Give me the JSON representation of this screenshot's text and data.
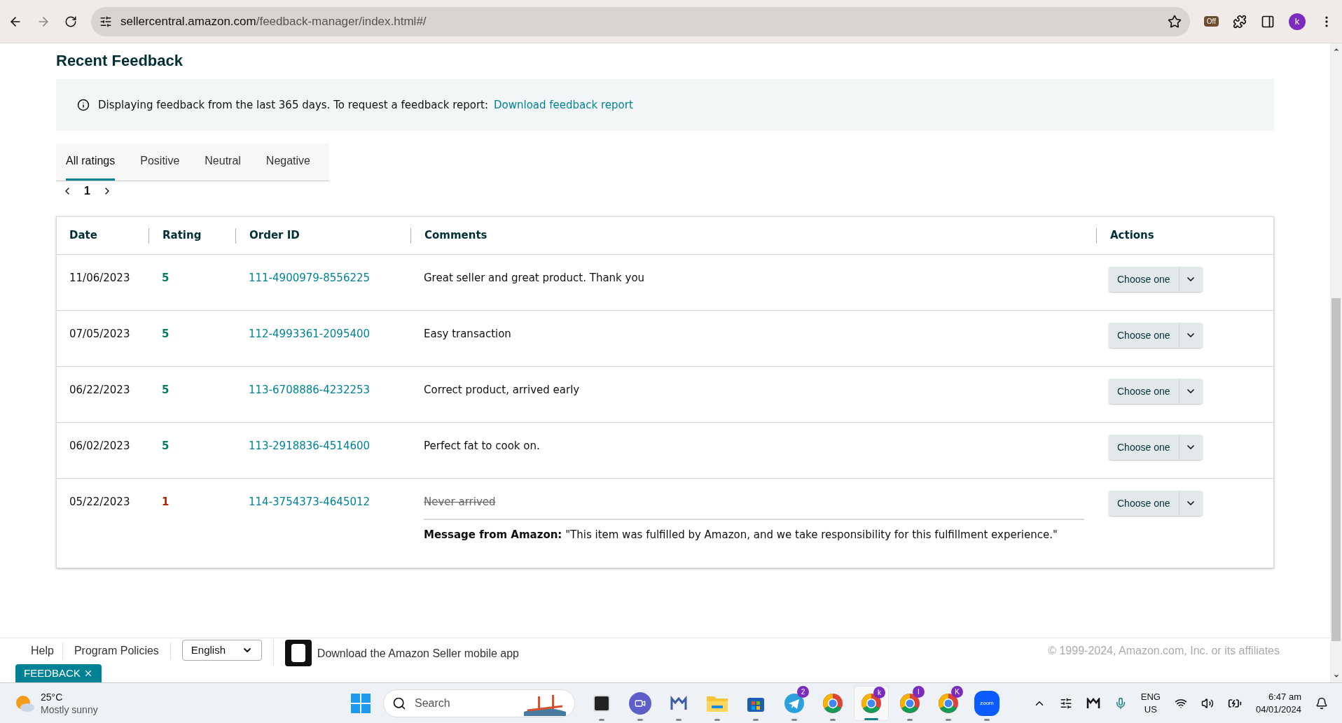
{
  "browser": {
    "url_host": "sellercentral.amazon.com",
    "url_path": "/feedback-manager/index.html#/",
    "extension_badge": "Off",
    "profile": "k"
  },
  "page": {
    "title": "Recent Feedback",
    "info": {
      "text": "Displaying feedback from the last 365 days. To request a feedback report:",
      "link": "Download feedback report"
    },
    "tabs": [
      {
        "label": "All ratings",
        "selected": true
      },
      {
        "label": "Positive",
        "selected": false
      },
      {
        "label": "Neutral",
        "selected": false
      },
      {
        "label": "Negative",
        "selected": false
      }
    ],
    "pager": {
      "page": "1"
    },
    "table": {
      "columns": [
        "Date",
        "Rating",
        "Order ID",
        "Comments",
        "Actions"
      ],
      "rows": [
        {
          "date": "11/06/2023",
          "rating": "5",
          "color": "#067d62",
          "order_id": "111-4900979-8556225",
          "comment": "Great seller and great product. Thank you",
          "struck": false,
          "action": "Choose one"
        },
        {
          "date": "07/05/2023",
          "rating": "5",
          "color": "#067d62",
          "order_id": "112-4993361-2095400",
          "comment": "Easy transaction",
          "struck": false,
          "action": "Choose one"
        },
        {
          "date": "06/22/2023",
          "rating": "5",
          "color": "#067d62",
          "order_id": "113-6708886-4232253",
          "comment": "Correct product, arrived early",
          "struck": false,
          "action": "Choose one"
        },
        {
          "date": "06/02/2023",
          "rating": "5",
          "color": "#067d62",
          "order_id": "113-2918836-4514600",
          "comment": "Perfect fat to cook on.",
          "struck": false,
          "action": "Choose one"
        },
        {
          "date": "05/22/2023",
          "rating": "1",
          "color": "#b12704",
          "order_id": "114-3754373-4645012",
          "comment": "Never arrived",
          "struck": true,
          "message": "**Message from Amazon:** \"This item was fulfilled by Amazon, and we take responsibility for this fulfillment experience.\"",
          "action": "Choose one"
        }
      ]
    }
  },
  "footer": {
    "links": [
      "Help",
      "Program Policies"
    ],
    "language": "English",
    "app_text": "Download the Amazon Seller mobile app",
    "copyright": "© 1999-2024, Amazon.com, Inc. or its affiliates",
    "feedback_tab": "FEEDBACK"
  },
  "taskbar": {
    "weather": {
      "temp": "25°C",
      "condition": "Mostly sunny"
    },
    "search_placeholder": "Search",
    "apps": [
      {
        "kind": "files",
        "selected": false
      },
      {
        "kind": "meet",
        "selected": false
      },
      {
        "kind": "m",
        "selected": false
      },
      {
        "kind": "folder",
        "selected": false
      },
      {
        "kind": "store",
        "selected": false
      },
      {
        "kind": "telegram",
        "badge": "2",
        "selected": false
      },
      {
        "kind": "chrome",
        "selected": false
      },
      {
        "kind": "chrome",
        "badge": "k",
        "selected": true
      },
      {
        "kind": "chrome",
        "badge": "I",
        "selected": false
      },
      {
        "kind": "chrome",
        "badge": "K",
        "selected": false
      },
      {
        "kind": "zoom",
        "label": "zoom",
        "selected": false
      }
    ],
    "lang": [
      "ENG",
      "US"
    ],
    "time": "6:47 am",
    "date": "04/01/2024"
  }
}
